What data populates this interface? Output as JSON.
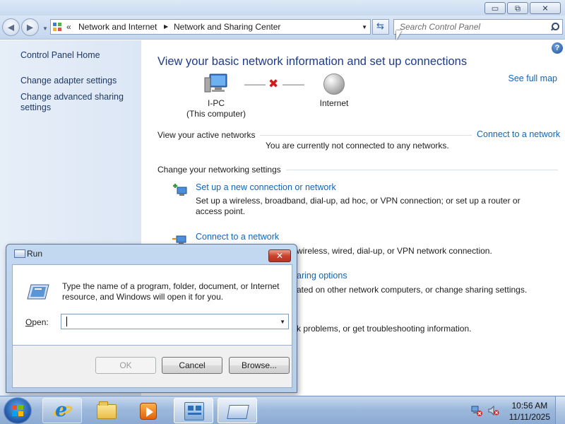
{
  "window": {
    "caption_buttons": {
      "minimize": "▭",
      "restore": "⧉",
      "close": "✕"
    }
  },
  "nav": {
    "back_glyph": "◀",
    "forward_glyph": "▶",
    "breadcrumb_chevron": "«",
    "breadcrumbs": [
      "Network and Internet",
      "Network and Sharing Center"
    ],
    "breadcrumb_separator": "▶",
    "search_placeholder": "Search Control Panel"
  },
  "left_pane": {
    "items": [
      {
        "label": "Control Panel Home"
      },
      {
        "label": "Change adapter settings"
      },
      {
        "label": "Change advanced sharing settings"
      }
    ]
  },
  "main": {
    "help_glyph": "?",
    "title": "View your basic network information and set up connections",
    "see_full_map": "See full map",
    "map": {
      "computer_name": "I-PC",
      "computer_caption": "(This computer)",
      "internet_label": "Internet",
      "disconnect_glyph": "✖"
    },
    "active_networks": {
      "heading": "View your active networks",
      "link": "Connect to a network",
      "status": "You are currently not connected to any networks."
    },
    "change_settings": {
      "heading": "Change your networking settings",
      "tasks": [
        {
          "link": "Set up a new connection or network",
          "desc": "Set up a wireless, broadband, dial-up, ad hoc, or VPN connection; or set up a router or access point."
        },
        {
          "link": "Connect to a network",
          "desc": "wireless, wired, dial-up, or VPN network connection."
        },
        {
          "link": "aring options",
          "desc": "ated on other network computers, or change sharing settings."
        },
        {
          "link": "",
          "desc": "k problems, or get troubleshooting information."
        }
      ]
    }
  },
  "run_dialog": {
    "title": "Run",
    "close_glyph": "✕",
    "description": "Type the name of a program, folder, document, or Internet resource, and Windows will open it for you.",
    "open_label_accel": "O",
    "open_label_rest": "pen:",
    "input_value": "",
    "dropdown_glyph": "▼",
    "buttons": {
      "ok": "OK",
      "cancel": "Cancel",
      "browse": "Browse..."
    }
  },
  "taskbar": {
    "clock_time": "10:56 AM",
    "clock_date": "11/11/2025"
  },
  "colors": {
    "link": "#1464b4",
    "title": "#1e3a8a",
    "disconnect_x": "#d11a1a"
  }
}
